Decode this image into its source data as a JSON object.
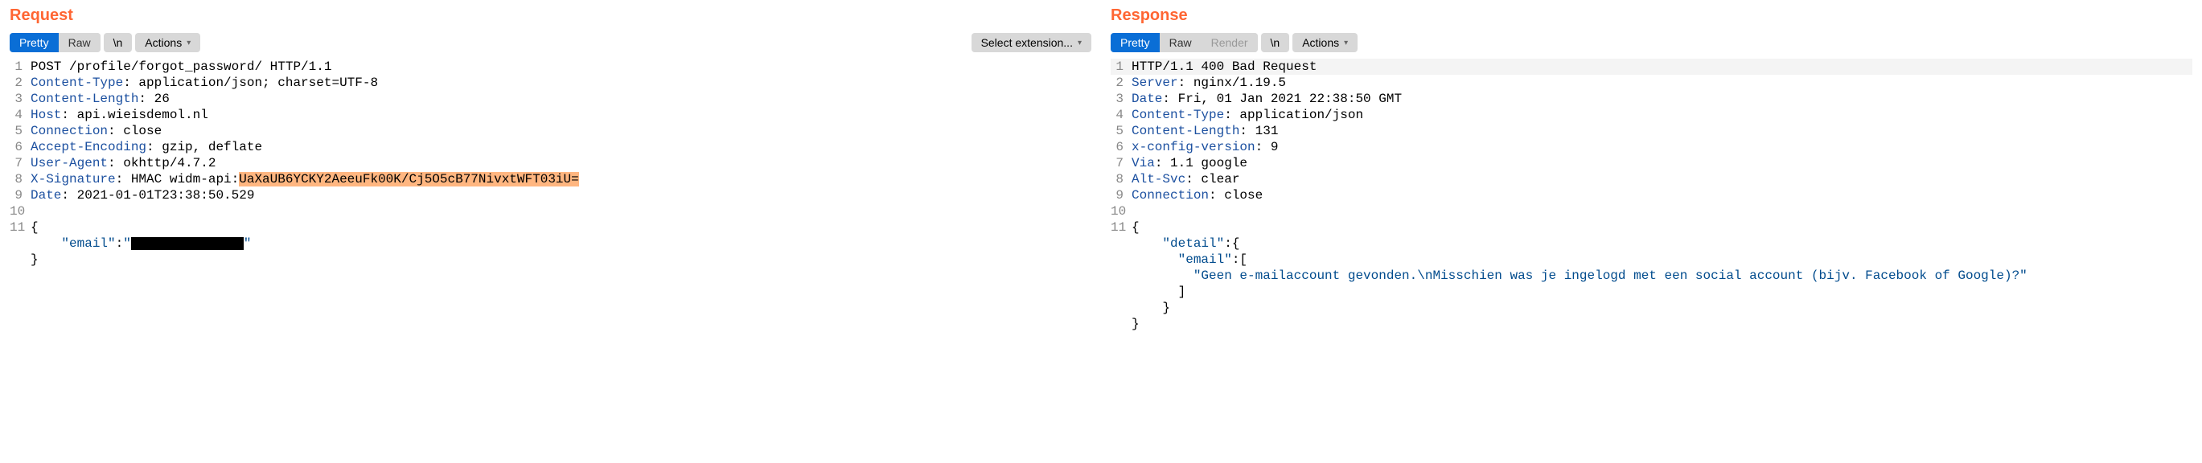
{
  "request": {
    "title": "Request",
    "tabs": {
      "pretty": "Pretty",
      "raw": "Raw"
    },
    "buttons": {
      "newline": "\\n",
      "actions": "Actions",
      "select_extension": "Select extension..."
    },
    "lines": [
      {
        "n": 1,
        "parts": [
          {
            "cls": "txt",
            "t": "POST /profile/forgot_password/ HTTP/1.1"
          }
        ]
      },
      {
        "n": 2,
        "parts": [
          {
            "cls": "hdr",
            "t": "Content-Type"
          },
          {
            "cls": "txt",
            "t": ": application/json; charset=UTF-8"
          }
        ]
      },
      {
        "n": 3,
        "parts": [
          {
            "cls": "hdr",
            "t": "Content-Length"
          },
          {
            "cls": "txt",
            "t": ": 26"
          }
        ]
      },
      {
        "n": 4,
        "parts": [
          {
            "cls": "hdr",
            "t": "Host"
          },
          {
            "cls": "txt",
            "t": ": api.wieisdemol.nl"
          }
        ]
      },
      {
        "n": 5,
        "parts": [
          {
            "cls": "hdr",
            "t": "Connection"
          },
          {
            "cls": "txt",
            "t": ": close"
          }
        ]
      },
      {
        "n": 6,
        "parts": [
          {
            "cls": "hdr",
            "t": "Accept-Encoding"
          },
          {
            "cls": "txt",
            "t": ": gzip, deflate"
          }
        ]
      },
      {
        "n": 7,
        "parts": [
          {
            "cls": "hdr",
            "t": "User-Agent"
          },
          {
            "cls": "txt",
            "t": ": okhttp/4.7.2"
          }
        ]
      },
      {
        "n": 8,
        "parts": [
          {
            "cls": "hdr",
            "t": "X-Signature"
          },
          {
            "cls": "txt",
            "t": ": HMAC widm-api:"
          },
          {
            "cls": "highlight",
            "t": "UaXaUB6YCKY2AeeuFk00K/Cj5O5cB77NivxtWFT03iU="
          }
        ]
      },
      {
        "n": 9,
        "parts": [
          {
            "cls": "hdr",
            "t": "Date"
          },
          {
            "cls": "txt",
            "t": ": 2021-01-01T23:38:50.529"
          }
        ]
      },
      {
        "n": 10,
        "parts": []
      },
      {
        "n": 11,
        "parts": [
          {
            "cls": "brace",
            "t": "{"
          }
        ]
      },
      {
        "n": "",
        "parts": [
          {
            "cls": "txt",
            "t": "    "
          },
          {
            "cls": "str",
            "t": "\"email\""
          },
          {
            "cls": "txt",
            "t": ":"
          },
          {
            "cls": "str",
            "t": "\""
          },
          {
            "cls": "redacted",
            "t": " "
          },
          {
            "cls": "str",
            "t": "\""
          }
        ]
      },
      {
        "n": "",
        "parts": [
          {
            "cls": "brace",
            "t": "}"
          }
        ]
      }
    ]
  },
  "response": {
    "title": "Response",
    "tabs": {
      "pretty": "Pretty",
      "raw": "Raw",
      "render": "Render"
    },
    "buttons": {
      "newline": "\\n",
      "actions": "Actions"
    },
    "lines": [
      {
        "n": 1,
        "cursor": true,
        "parts": [
          {
            "cls": "txt",
            "t": "HTTP/1.1 400 Bad Request"
          }
        ]
      },
      {
        "n": 2,
        "parts": [
          {
            "cls": "hdr",
            "t": "Server"
          },
          {
            "cls": "txt",
            "t": ": nginx/1.19.5"
          }
        ]
      },
      {
        "n": 3,
        "parts": [
          {
            "cls": "hdr",
            "t": "Date"
          },
          {
            "cls": "txt",
            "t": ": Fri, 01 Jan 2021 22:38:50 GMT"
          }
        ]
      },
      {
        "n": 4,
        "parts": [
          {
            "cls": "hdr",
            "t": "Content-Type"
          },
          {
            "cls": "txt",
            "t": ": application/json"
          }
        ]
      },
      {
        "n": 5,
        "parts": [
          {
            "cls": "hdr",
            "t": "Content-Length"
          },
          {
            "cls": "txt",
            "t": ": 131"
          }
        ]
      },
      {
        "n": 6,
        "parts": [
          {
            "cls": "hdr",
            "t": "x-config-version"
          },
          {
            "cls": "txt",
            "t": ": 9"
          }
        ]
      },
      {
        "n": 7,
        "parts": [
          {
            "cls": "hdr",
            "t": "Via"
          },
          {
            "cls": "txt",
            "t": ": 1.1 google"
          }
        ]
      },
      {
        "n": 8,
        "parts": [
          {
            "cls": "hdr",
            "t": "Alt-Svc"
          },
          {
            "cls": "txt",
            "t": ": clear"
          }
        ]
      },
      {
        "n": 9,
        "parts": [
          {
            "cls": "hdr",
            "t": "Connection"
          },
          {
            "cls": "txt",
            "t": ": close"
          }
        ]
      },
      {
        "n": 10,
        "parts": []
      },
      {
        "n": 11,
        "parts": [
          {
            "cls": "brace",
            "t": "{"
          }
        ]
      },
      {
        "n": "",
        "parts": [
          {
            "cls": "txt",
            "t": "    "
          },
          {
            "cls": "str",
            "t": "\"detail\""
          },
          {
            "cls": "txt",
            "t": ":{"
          }
        ]
      },
      {
        "n": "",
        "parts": [
          {
            "cls": "txt",
            "t": "      "
          },
          {
            "cls": "str",
            "t": "\"email\""
          },
          {
            "cls": "txt",
            "t": ":["
          }
        ]
      },
      {
        "n": "",
        "parts": [
          {
            "cls": "txt",
            "t": "        "
          },
          {
            "cls": "str",
            "t": "\"Geen e-mailaccount gevonden.\\nMisschien was je ingelogd met een social account (bijv. Facebook of Google)?\""
          }
        ]
      },
      {
        "n": "",
        "parts": [
          {
            "cls": "txt",
            "t": "      ]"
          }
        ]
      },
      {
        "n": "",
        "parts": [
          {
            "cls": "txt",
            "t": "    }"
          }
        ]
      },
      {
        "n": "",
        "parts": [
          {
            "cls": "brace",
            "t": "}"
          }
        ]
      }
    ]
  }
}
